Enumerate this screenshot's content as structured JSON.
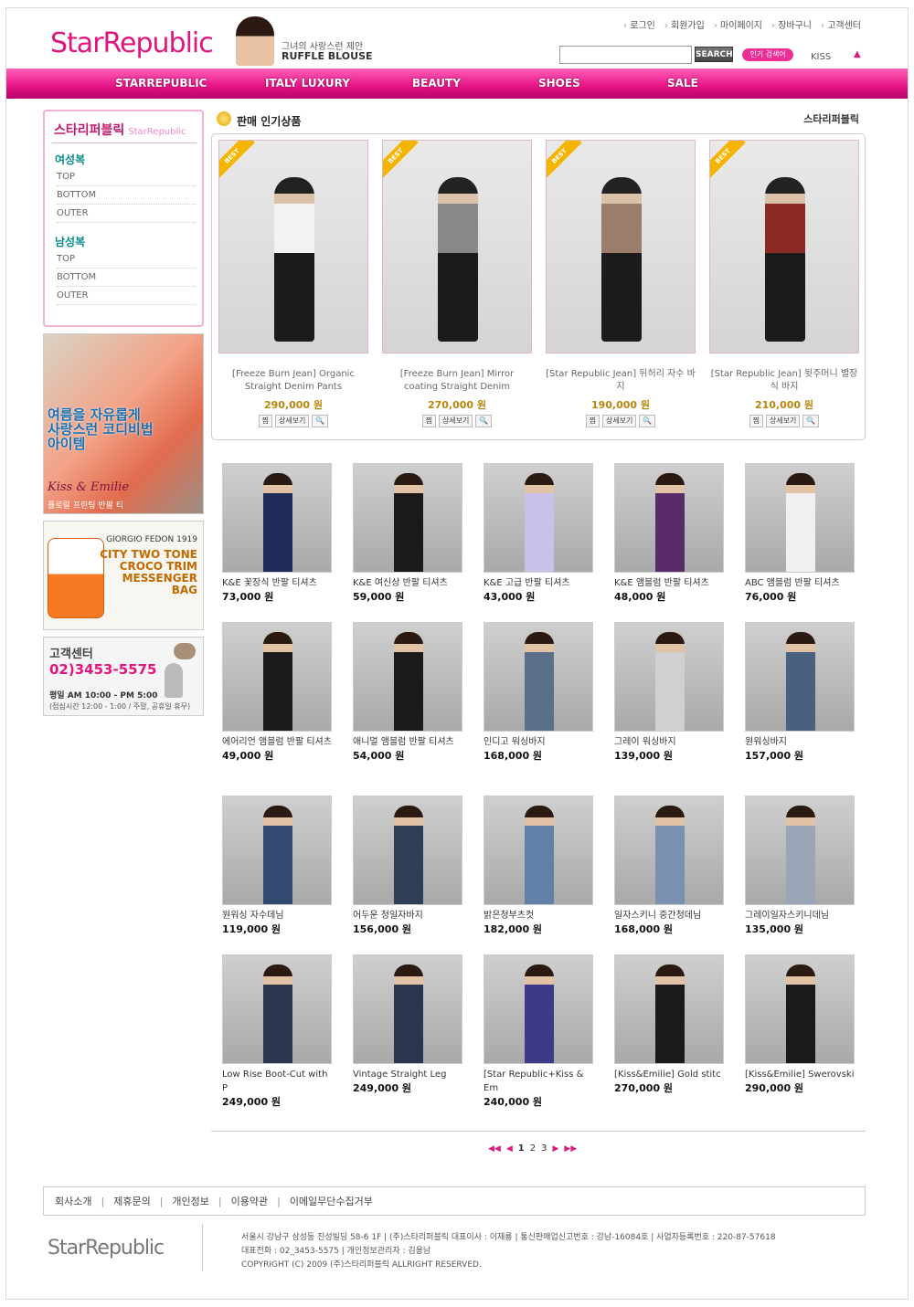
{
  "header": {
    "logo": "StarRepublic",
    "promo_line1": "그녀의 사랑스런 제안",
    "promo_line2": "RUFFLE BLOUSE",
    "top_links": [
      "로그인",
      "회원가입",
      "마이페이지",
      "장바구니",
      "고객센터"
    ],
    "search_placeholder": "",
    "search_button": "SEARCH",
    "popular_tag": "인기 검색어",
    "popular_keyword": "KISS"
  },
  "nav": [
    "STARREPUBLIC",
    "ITALY LUXURY",
    "BEAUTY",
    "SHOES",
    "SALE"
  ],
  "sidebar": {
    "title": "스타리퍼블릭",
    "title_en": "StarRepublic",
    "sections": [
      {
        "title": "여성복",
        "items": [
          "TOP",
          "BOTTOM",
          "OUTER"
        ]
      },
      {
        "title": "남성복",
        "items": [
          "TOP",
          "BOTTOM",
          "OUTER"
        ]
      }
    ],
    "banner1": {
      "line1": "여름을 자유롭게",
      "line2": "사랑스런 코디비법",
      "line3": "아이템",
      "brand": "Kiss & Emilie",
      "caption": "플로럴 프린팅 반팔 티"
    },
    "banner2": {
      "brand": "GIORGIO FEDON 1919",
      "line1": "CITY TWO TONE",
      "line2": "CROCO TRIM",
      "line3": "MESSENGER",
      "line4": "BAG"
    },
    "banner3": {
      "title": "고객센터",
      "phone": "02)3453-5575",
      "hours": "평일 AM 10:00 - PM 5:00",
      "note": "(점심시간 12:00 - 1:00 / 주말, 공휴일 휴무)"
    }
  },
  "featured": {
    "title": "판매 인기상품",
    "link": "스타리퍼블릭",
    "ribbon": "BEST",
    "buttons": {
      "wish": "찜",
      "detail": "상세보기",
      "zoom": "🔍"
    },
    "items": [
      {
        "name": "[Freeze Burn Jean] Organic Straight Denim Pants",
        "price": "290,000 원"
      },
      {
        "name": "[Freeze Burn Jean] Mirror coating Straight Denim",
        "price": "270,000 원"
      },
      {
        "name": "[Star Republic Jean] 뒤허리 자수 바지",
        "price": "190,000 원"
      },
      {
        "name": "[Star Republic Jean] 뒷주머니 별장식 바지",
        "price": "210,000 원"
      }
    ]
  },
  "products": [
    {
      "name": "K&E 꽃장식 반팔 티셔츠",
      "price": "73,000 원"
    },
    {
      "name": "K&E 여신상 반팔 티셔츠",
      "price": "59,000 원"
    },
    {
      "name": "K&E 고급 반팔 티셔츠",
      "price": "43,000 원"
    },
    {
      "name": "K&E 앰블럼 반팔 티셔츠",
      "price": "48,000 원"
    },
    {
      "name": "ABC 앰블럼 반팔 티셔츠",
      "price": "76,000 원"
    },
    {
      "name": "에어리언 앰블럼 반팔 티셔츠",
      "price": "49,000 원"
    },
    {
      "name": "애니멀 앰블럼 반팔 티셔츠",
      "price": "54,000 원"
    },
    {
      "name": "인디고 워싱바지",
      "price": "168,000 원"
    },
    {
      "name": "그레이 워싱바지",
      "price": "139,000 원"
    },
    {
      "name": "원워싱바지",
      "price": "157,000 원"
    },
    {
      "name": "원워싱 자수데님",
      "price": "119,000 원"
    },
    {
      "name": "어두운 청일자바지",
      "price": "156,000 원"
    },
    {
      "name": "밝은청부츠컷",
      "price": "182,000 원"
    },
    {
      "name": "일자스키니 중간청데님",
      "price": "168,000 원"
    },
    {
      "name": "그레이일자스키니데님",
      "price": "135,000 원"
    },
    {
      "name": "Low Rise Boot-Cut with P",
      "price": "249,000 원"
    },
    {
      "name": "Vintage Straight Leg",
      "price": "249,000 원"
    },
    {
      "name": "[Star Republic+Kiss & Em",
      "price": "240,000 원"
    },
    {
      "name": "[Kiss&Emilie] Gold stitc",
      "price": "270,000 원"
    },
    {
      "name": "[Kiss&Emilie] Swerovski",
      "price": "290,000 원"
    }
  ],
  "pager": {
    "first": "◀◀",
    "prev": "◀",
    "pages": [
      "1",
      "2",
      "3"
    ],
    "next": "▶",
    "last": "▶▶"
  },
  "footer": {
    "links": [
      "회사소개",
      "제휴문의",
      "개인정보",
      "이용약관",
      "이메일무단수집거부"
    ],
    "logo": "StarRepublic",
    "line1": "서울시 강남구 삼성동 진성빌딩 58-6 1F | (주)스타리퍼블릭 대표이사 : 이재룡 | 통신판매업신고번호 : 강남-16084호 | 사업자등록번호 : 220-87-57618",
    "line2": "대표전화 : 02_3453-5575 | 개인정보관리자 : 김용남",
    "line3": "COPYRIGHT (C) 2009 (주)스타리퍼블릭 ALLRIGHT RESERVED."
  },
  "colors": {
    "brand": "#e0167f",
    "teal": "#0a8a8a",
    "price_gold": "#b8860b"
  }
}
